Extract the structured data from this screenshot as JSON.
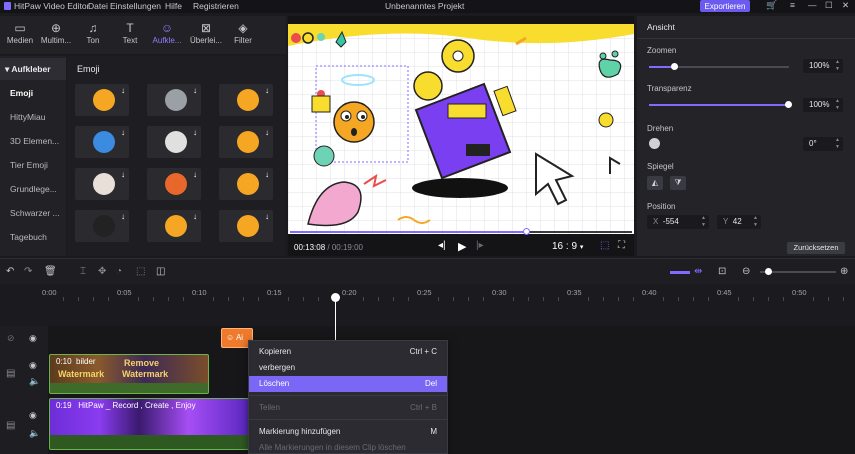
{
  "titlebar": {
    "app_name": "HitPaw Video Editor",
    "menus": [
      "Datei",
      "Einstellungen",
      "Hilfe",
      "Registrieren"
    ],
    "project_title": "Unbenanntes Projekt",
    "export_label": "Exportieren"
  },
  "toolbar": {
    "tools": [
      {
        "label": "Medien",
        "icon": "▭"
      },
      {
        "label": "Multim...",
        "icon": "⊕"
      },
      {
        "label": "Ton",
        "icon": "♫"
      },
      {
        "label": "Text",
        "icon": "T"
      },
      {
        "label": "Aufkle...",
        "icon": "☺"
      },
      {
        "label": "Überlei...",
        "icon": "⊠"
      },
      {
        "label": "Filter",
        "icon": "◈"
      }
    ]
  },
  "sidebar": {
    "header": "Aufkleber",
    "items": [
      "Emoji",
      "HittyMiau",
      "3D Elemen...",
      "Tier Emoji",
      "Grundlege...",
      "Schwarzer ...",
      "Tagebuch"
    ]
  },
  "grid": {
    "title": "Emoji",
    "emoji_colors": [
      "#f5a623",
      "#9aa0a6",
      "#f5a623",
      "#3b8be0",
      "#e0e0e0",
      "#f5a623",
      "#e8e0d8",
      "#e8672a",
      "#f5a623",
      "#222222",
      "#f5a623",
      "#f5a623"
    ]
  },
  "preview": {
    "current_time": "00:13:08",
    "total_time": "00:19:00",
    "progress": 0.69,
    "aspect_ratio": "16 : 9"
  },
  "panel": {
    "header": "Ansicht",
    "zoom_label": "Zoomen",
    "zoom_value": "100%",
    "zoom_level": 0.18,
    "transparency_label": "Transparenz",
    "transparency_value": "100%",
    "transparency_level": 1.0,
    "rotate_label": "Drehen",
    "rotate_value": "0°",
    "mirror_label": "Spiegel",
    "position_label": "Position",
    "pos_x_label": "X",
    "pos_x_value": "-554",
    "pos_y_label": "Y",
    "pos_y_value": "42",
    "reset_label": "Zurücksetzen"
  },
  "ruler": {
    "ticks": [
      "0:00",
      "0:05",
      "0:10",
      "0:15",
      "0:20",
      "0:25",
      "0:30",
      "0:35",
      "0:40",
      "0:45",
      "0:50"
    ]
  },
  "tracks": {
    "sticker_clip_label": "Ai",
    "clip1": {
      "time": "0:10",
      "name": "bilder",
      "overlay1": "Remove",
      "overlay2": "Watermark"
    },
    "clip2": {
      "time": "0:19",
      "name": "HitPaw _ Record , Create , Enjoy"
    }
  },
  "context_menu": {
    "items": [
      {
        "label": "Kopieren",
        "shortcut": "Ctrl + C"
      },
      {
        "label": "verbergen",
        "shortcut": ""
      },
      {
        "label": "Löschen",
        "shortcut": "Del"
      },
      {
        "label": "Teilen",
        "shortcut": "Ctrl + B"
      },
      {
        "label": "Markierung hinzufügen",
        "shortcut": "M"
      },
      {
        "label": "Alle Markierungen in diesem Clip löschen",
        "shortcut": ""
      }
    ]
  }
}
